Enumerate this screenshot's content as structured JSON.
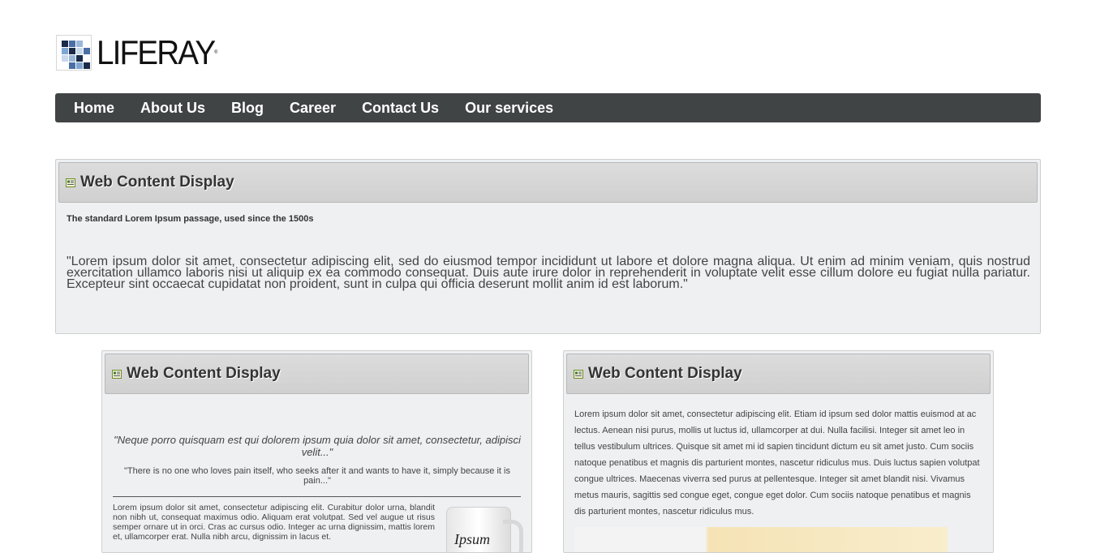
{
  "logo": {
    "text": "LIFERAY",
    "mark": "®"
  },
  "nav": {
    "items": [
      {
        "label": "Home"
      },
      {
        "label": "About Us"
      },
      {
        "label": "Blog"
      },
      {
        "label": "Career"
      },
      {
        "label": "Contact Us"
      },
      {
        "label": "Our services"
      }
    ]
  },
  "portlets": [
    {
      "title": "Web Content Display",
      "subtitle": "The standard Lorem Ipsum passage, used since the 1500s",
      "body": "\"Lorem ipsum dolor sit amet, consectetur adipiscing elit, sed do eiusmod tempor incididunt ut labore et dolore magna aliqua. Ut enim ad minim veniam, quis nostrud exercitation ullamco laboris nisi ut aliquip ex ea commodo consequat. Duis aute irure dolor in reprehenderit in voluptate velit esse cillum dolore eu fugiat nulla pariatur. Excepteur sint occaecat cupidatat non proident, sunt in culpa qui officia deserunt mollit anim id est laborum.\""
    },
    {
      "title": "Web Content Display",
      "quote": "\"Neque porro quisquam est qui dolorem ipsum quia dolor sit amet, consectetur, adipisci velit...\"",
      "quote_sub": "\"There is no one who loves pain itself, who seeks after it and wants to have it, simply because it is pain...\"",
      "body": "Lorem ipsum dolor sit amet, consectetur adipiscing elit. Curabitur dolor urna, blandit non nibh ut, consequat maximus odio. Aliquam erat volutpat. Sed vel augue ut risus semper ornare ut in orci. Cras ac cursus odio. Integer ac urna dignissim, mattis lorem et, ullamcorper erat. Nulla nibh arcu, dignissim in lacus et.",
      "mug_text": "Ipsum"
    },
    {
      "title": "Web Content Display",
      "body": "Lorem ipsum dolor sit amet, consectetur adipiscing elit. Etiam id ipsum sed dolor mattis euismod at ac lectus. Aenean nisi purus, mollis ut luctus id, ullamcorper at dui. Nulla facilisi. Integer sit amet leo in tellus vestibulum ultrices. Quisque sit amet mi id sapien tincidunt dictum eu sit amet justo. Cum sociis natoque penatibus et magnis dis parturient montes, nascetur ridiculus mus. Duis luctus sapien volutpat congue ultrices. Maecenas viverra sed purus at pellentesque. Integer sit amet blandit nisi. Vivamus metus mauris, sagittis sed congue eget, congue eget dolor. Cum sociis natoque penatibus et magnis dis parturient montes, nascetur ridiculus mus."
    }
  ],
  "icons": {
    "portlet_title": "web-content-icon"
  },
  "colors": {
    "nav_bg": "#414445",
    "portlet_bg": "#eef0f2",
    "title_bar": "#d4d4d4"
  }
}
